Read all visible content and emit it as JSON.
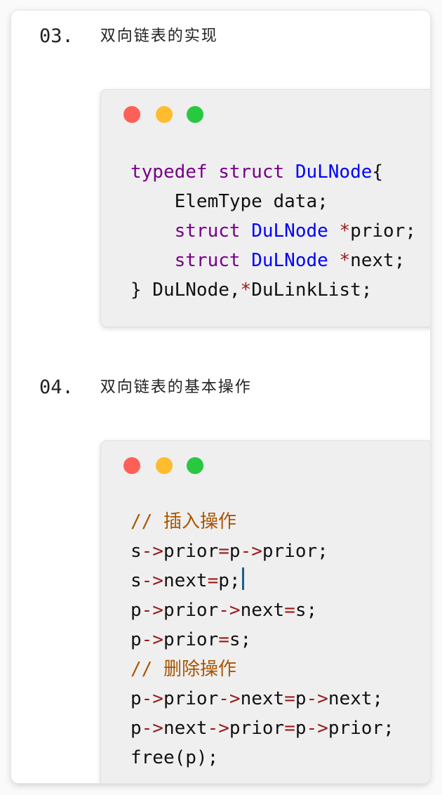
{
  "section3": {
    "number": "03.",
    "title": "双向链表的实现"
  },
  "section4": {
    "number": "04.",
    "title": "双向链表的基本操作"
  },
  "code1": {
    "l1_kw": "typedef struct ",
    "l1_type": "DuLNode",
    "l1_end": "{",
    "l2": "    ElemType data;",
    "l3_indent": "    ",
    "l3_kw": "struct",
    "l3_sp": " ",
    "l3_type": "DuLNode",
    "l3_sp2": " ",
    "l3_op": "*",
    "l3_rest": "prior;",
    "l4_indent": "    ",
    "l4_kw": "struct",
    "l4_sp": " ",
    "l4_type": "DuLNode",
    "l4_sp2": " ",
    "l4_op": "*",
    "l4_rest": "next;",
    "l5_a": "} DuLNode,",
    "l5_op": "*",
    "l5_b": "DuLinkList;"
  },
  "code2": {
    "c1": "// 插入操作",
    "l1": [
      "s",
      "->",
      "prior",
      "=",
      "p",
      "->",
      "prior;"
    ],
    "l2": [
      "s",
      "->",
      "next",
      "=",
      "p;"
    ],
    "l3": [
      "p",
      "->",
      "prior",
      "->",
      "next",
      "=",
      "s;"
    ],
    "l4": [
      "p",
      "->",
      "prior",
      "=",
      "s;"
    ],
    "c2": "// 删除操作",
    "l5": [
      "p",
      "->",
      "prior",
      "->",
      "next",
      "=",
      "p",
      "->",
      "next;"
    ],
    "l6": [
      "p",
      "->",
      "next",
      "->",
      "prior",
      "=",
      "p",
      "->",
      "prior;"
    ],
    "l7": "free(p);"
  }
}
